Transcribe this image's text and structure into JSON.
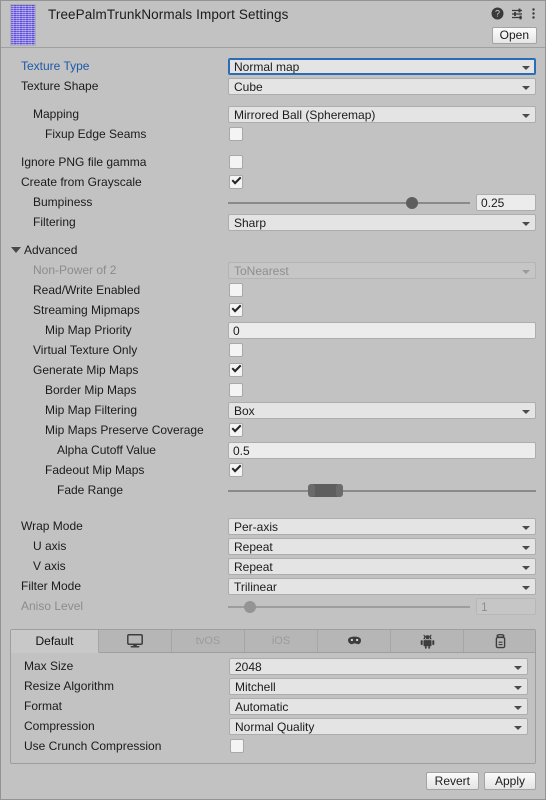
{
  "header": {
    "title": "TreePalmTrunkNormals Import Settings",
    "open_label": "Open",
    "help_icon": "help-circle-icon",
    "preset_icon": "preset-sliders-icon",
    "menu_icon": "kebab-menu-icon",
    "thumbnail": "normal-map-texture-preview"
  },
  "main": {
    "texture_type": {
      "label": "Texture Type",
      "value": "Normal map"
    },
    "texture_shape": {
      "label": "Texture Shape",
      "value": "Cube"
    },
    "mapping": {
      "label": "Mapping",
      "value": "Mirrored Ball (Spheremap)"
    },
    "fixup_edge_seams": {
      "label": "Fixup Edge Seams",
      "checked": false
    },
    "ignore_png_gamma": {
      "label": "Ignore PNG file gamma",
      "checked": false
    },
    "create_from_grayscale": {
      "label": "Create from Grayscale",
      "checked": true
    },
    "bumpiness": {
      "label": "Bumpiness",
      "value": "0.25",
      "percent": 76
    },
    "filtering": {
      "label": "Filtering",
      "value": "Sharp"
    }
  },
  "advanced": {
    "label": "Advanced",
    "expanded": true,
    "non_power_of_2": {
      "label": "Non-Power of 2",
      "value": "ToNearest",
      "disabled": true
    },
    "read_write_enabled": {
      "label": "Read/Write Enabled",
      "checked": false
    },
    "streaming_mipmaps": {
      "label": "Streaming Mipmaps",
      "checked": true
    },
    "mip_map_priority": {
      "label": "Mip Map Priority",
      "value": "0"
    },
    "virtual_texture_only": {
      "label": "Virtual Texture Only",
      "checked": false
    },
    "generate_mip_maps": {
      "label": "Generate Mip Maps",
      "checked": true
    },
    "border_mip_maps": {
      "label": "Border Mip Maps",
      "checked": false
    },
    "mip_map_filtering": {
      "label": "Mip Map Filtering",
      "value": "Box"
    },
    "mip_maps_preserve_coverage": {
      "label": "Mip Maps Preserve Coverage",
      "checked": true
    },
    "alpha_cutoff_value": {
      "label": "Alpha Cutoff Value",
      "value": "0.5"
    },
    "fadeout_mip_maps": {
      "label": "Fadeout Mip Maps",
      "checked": true
    },
    "fade_range": {
      "label": "Fade Range",
      "min_percent": 27,
      "max_percent": 36
    }
  },
  "wrap": {
    "wrap_mode": {
      "label": "Wrap Mode",
      "value": "Per-axis"
    },
    "u_axis": {
      "label": "U axis",
      "value": "Repeat"
    },
    "v_axis": {
      "label": "V axis",
      "value": "Repeat"
    },
    "filter_mode": {
      "label": "Filter Mode",
      "value": "Trilinear"
    },
    "aniso_level": {
      "label": "Aniso Level",
      "value": "1",
      "percent": 9,
      "disabled": true
    }
  },
  "platform": {
    "tabs": [
      {
        "label": "Default",
        "icon": "",
        "selected": true
      },
      {
        "label": "",
        "icon": "standalone-monitor-icon",
        "selected": false
      },
      {
        "label": "tvOS",
        "icon": "",
        "selected": false
      },
      {
        "label": "iOS",
        "icon": "",
        "selected": false
      },
      {
        "label": "",
        "icon": "visionos-headset-icon",
        "selected": false
      },
      {
        "label": "",
        "icon": "android-robot-icon",
        "selected": false
      },
      {
        "label": "",
        "icon": "webgl-icon",
        "selected": false
      }
    ],
    "max_size": {
      "label": "Max Size",
      "value": "2048"
    },
    "resize_algorithm": {
      "label": "Resize Algorithm",
      "value": "Mitchell"
    },
    "format": {
      "label": "Format",
      "value": "Automatic"
    },
    "compression": {
      "label": "Compression",
      "value": "Normal Quality"
    },
    "use_crunch_compression": {
      "label": "Use Crunch Compression",
      "checked": false
    }
  },
  "footer": {
    "revert_label": "Revert",
    "apply_label": "Apply"
  }
}
